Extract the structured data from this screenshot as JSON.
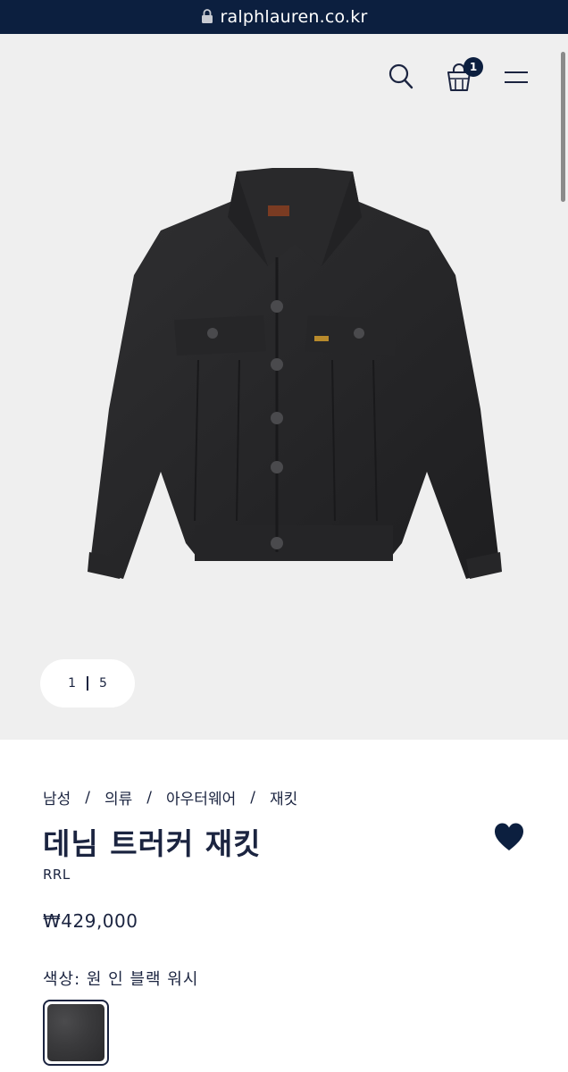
{
  "browser": {
    "url": "ralphlauren.co.kr",
    "lock_icon": "lock-icon"
  },
  "header": {
    "icons": [
      "search-icon",
      "shopping-bag-icon",
      "hamburger-menu-icon"
    ],
    "bag_count": "1"
  },
  "gallery": {
    "current": "1",
    "total": "5",
    "image_alt": "black denim trucker jacket"
  },
  "breadcrumb": [
    "남성",
    "의류",
    "아우터웨어",
    "재킷"
  ],
  "breadcrumb_separator": "/",
  "product": {
    "title": "데님 트러커 재킷",
    "brand": "RRL",
    "price": "₩429,000",
    "color_label": "색상: 원 인 블랙 워시",
    "wishlist_icon": "heart-icon",
    "wishlisted": true,
    "swatch_color": "#3a3a3c"
  },
  "colors": {
    "navy": "#0c1f3f",
    "gallery_bg": "#efefef",
    "text": "#1b2440"
  }
}
